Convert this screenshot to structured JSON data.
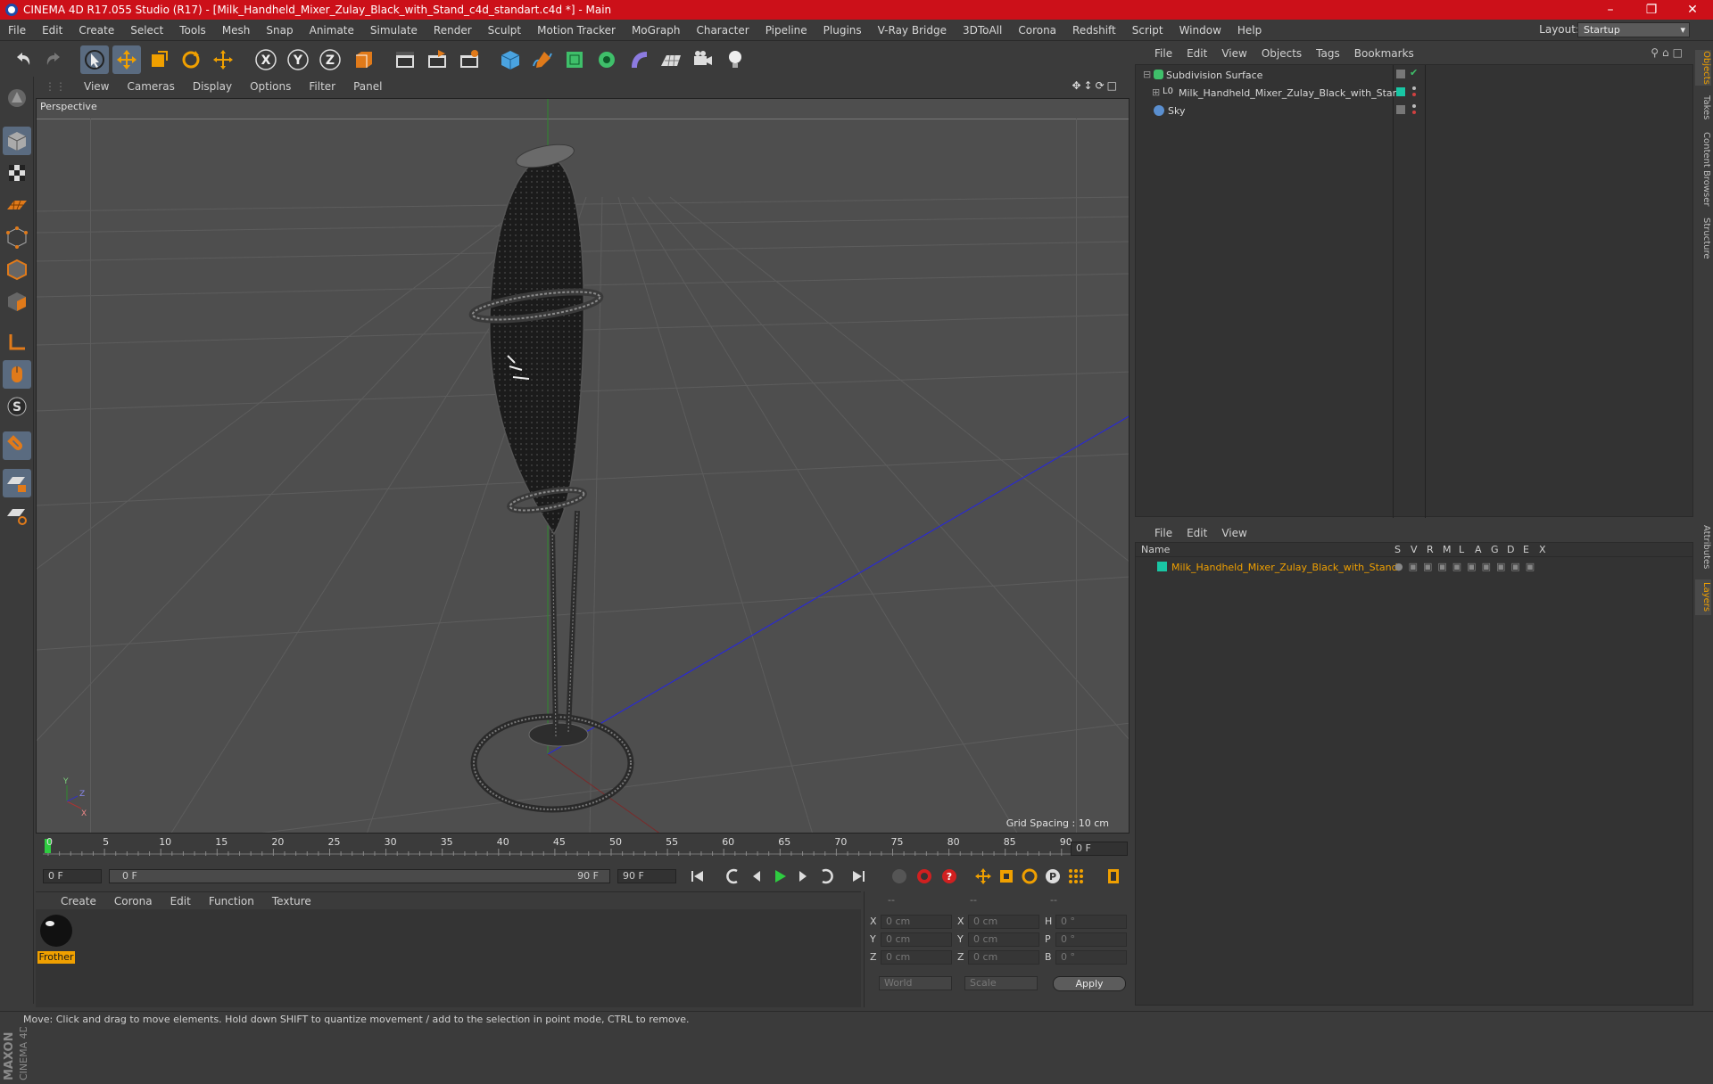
{
  "window": {
    "title": "CINEMA 4D R17.055 Studio (R17) - [Milk_Handheld_Mixer_Zulay_Black_with_Stand_c4d_standart.c4d *] - Main"
  },
  "menu": [
    "File",
    "Edit",
    "Create",
    "Select",
    "Tools",
    "Mesh",
    "Snap",
    "Animate",
    "Simulate",
    "Render",
    "Sculpt",
    "Motion Tracker",
    "MoGraph",
    "Character",
    "Pipeline",
    "Plugins",
    "V-Ray Bridge",
    "3DToAll",
    "Corona",
    "Redshift",
    "Script",
    "Window",
    "Help"
  ],
  "layout": {
    "label": "Layout:",
    "value": "Startup"
  },
  "viewport": {
    "menu": [
      "View",
      "Cameras",
      "Display",
      "Options",
      "Filter",
      "Panel"
    ],
    "label": "Perspective",
    "grid_spacing": "Grid Spacing : 10 cm"
  },
  "timeline": {
    "ticks": [
      "0",
      "5",
      "10",
      "15",
      "20",
      "25",
      "30",
      "35",
      "40",
      "45",
      "50",
      "55",
      "60",
      "65",
      "70",
      "75",
      "80",
      "85",
      "90"
    ],
    "current_frame": "0 F",
    "start_field": "0 F",
    "slider_left": "0 F",
    "slider_right": "90 F",
    "end_field": "90 F"
  },
  "material_manager": {
    "menu": [
      "Create",
      "Corona",
      "Edit",
      "Function",
      "Texture"
    ],
    "material_name": "Frother"
  },
  "coordinates": {
    "header": [
      "--",
      "--",
      "--"
    ],
    "rows": [
      {
        "a": "X",
        "av": "0 cm",
        "b": "X",
        "bv": "0 cm",
        "c": "H",
        "cv": "0 °"
      },
      {
        "a": "Y",
        "av": "0 cm",
        "b": "Y",
        "bv": "0 cm",
        "c": "P",
        "cv": "0 °"
      },
      {
        "a": "Z",
        "av": "0 cm",
        "b": "Z",
        "bv": "0 cm",
        "c": "B",
        "cv": "0 °"
      }
    ],
    "world": "World",
    "scale": "Scale",
    "apply": "Apply"
  },
  "object_manager": {
    "menu": [
      "File",
      "Edit",
      "View",
      "Objects",
      "Tags",
      "Bookmarks"
    ],
    "objects": [
      "Subdivision Surface",
      "Milk_Handheld_Mixer_Zulay_Black_with_Stand",
      "Sky"
    ]
  },
  "layer_manager": {
    "menu": [
      "File",
      "Edit",
      "View"
    ],
    "columns": [
      "Name",
      "S",
      "V",
      "R",
      "M",
      "L",
      "A",
      "G",
      "D",
      "E",
      "X"
    ],
    "layer_name": "Milk_Handheld_Mixer_Zulay_Black_with_Stand"
  },
  "side_tabs": [
    "Objects",
    "Takes",
    "Content Browser",
    "Structure",
    "Attributes",
    "Layers"
  ],
  "status": "Move: Click and drag to move elements. Hold down SHIFT to quantize movement / add to the selection in point mode, CTRL to remove.",
  "colors": {
    "title_bar": "#cc1019",
    "accent": "#f0a000",
    "layer_color": "#19c6a4"
  }
}
